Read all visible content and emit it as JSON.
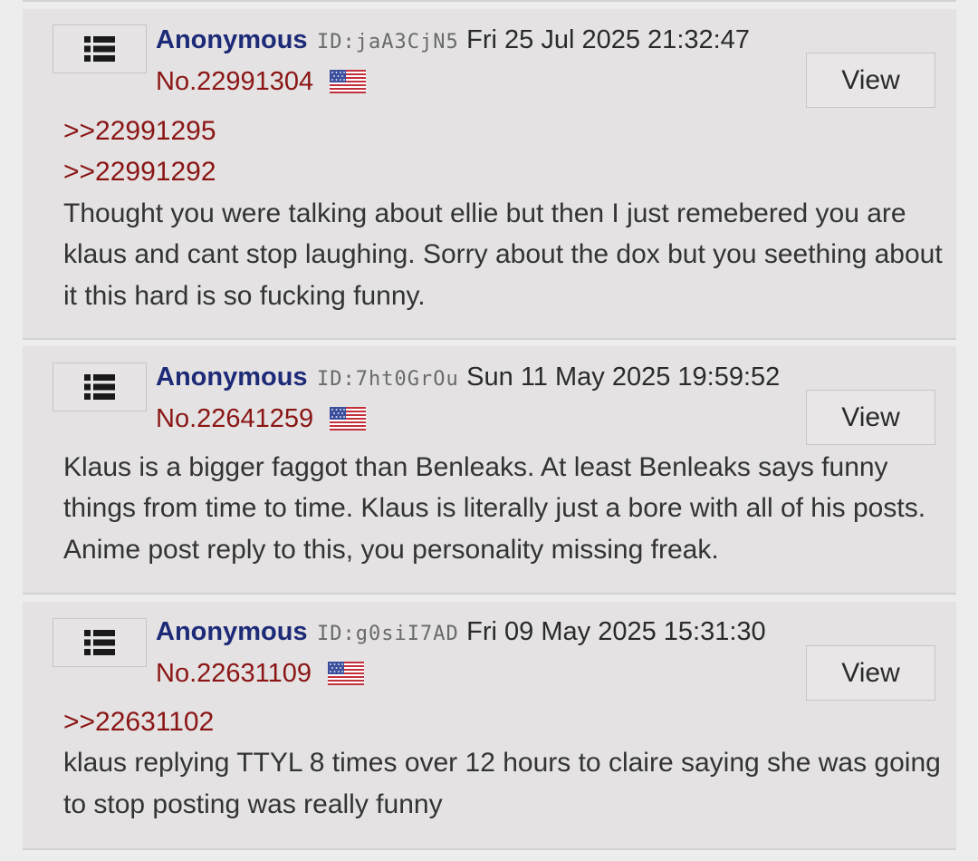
{
  "posts": [
    {
      "name": "Anonymous",
      "poster_id": "ID:jaA3CjN5",
      "date": "Fri 25 Jul 2025 21:32:47",
      "post_no": "No.22991304",
      "flag": "us-flag-icon",
      "view_label": "View",
      "quotes": [
        ">>22991295",
        ">>22991292"
      ],
      "text": "Thought you were talking about ellie but then I just remebered you are klaus and cant stop laughing. Sorry about the dox but you seething about it this hard is so fucking funny."
    },
    {
      "name": "Anonymous",
      "poster_id": "ID:7ht0GrOu",
      "date": "Sun 11 May 2025 19:59:52",
      "post_no": "No.22641259",
      "flag": "us-flag-icon",
      "view_label": "View",
      "quotes": [],
      "text": "Klaus is a bigger faggot than Benleaks. At least Benleaks says funny things from time to time. Klaus is literally just a bore with all of his posts. Anime post reply to this, you personality missing freak."
    },
    {
      "name": "Anonymous",
      "poster_id": "ID:g0siI7AD",
      "date": "Fri 09 May 2025 15:31:30",
      "post_no": "No.22631109",
      "flag": "us-flag-icon",
      "view_label": "View",
      "quotes": [
        ">>22631102"
      ],
      "text": "klaus replying TTYL 8 times over 12 hours to claire saying she was going to stop posting was really funny"
    }
  ],
  "colors": {
    "name": "#1d2a78",
    "post_no": "#8b1515",
    "quote_link": "#8b1515",
    "post_bg": "#e4e2e2",
    "page_bg": "#ededed"
  }
}
